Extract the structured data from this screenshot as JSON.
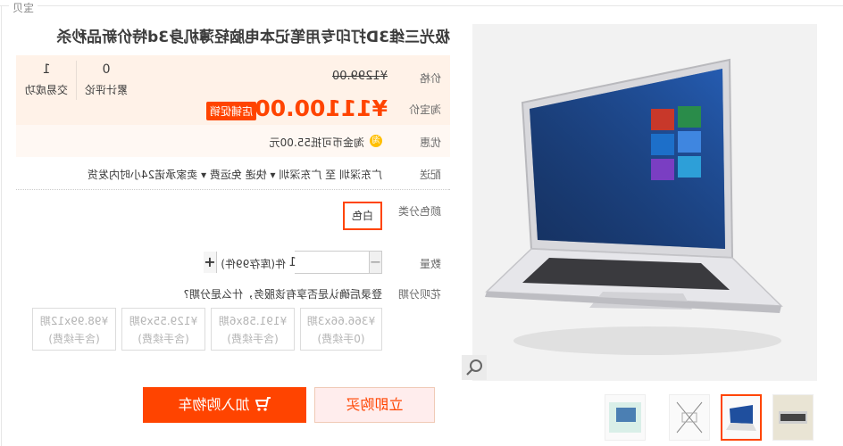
{
  "section_tag": "宝贝",
  "title": "极光三维3D打印专用笔记本电脑轻薄机身3d特价新品秒杀",
  "price": {
    "label": "价格",
    "original": "¥1299.00",
    "promo_label": "淘宝价",
    "current": "¥11100.00",
    "badge": "店铺促销"
  },
  "stats": [
    {
      "value": "0",
      "label": "累计评论"
    },
    {
      "value": "1",
      "label": "交易成功"
    }
  ],
  "promo": {
    "label": "优惠",
    "coin_icon": "coin-icon",
    "text": "淘金币可抵55.00元"
  },
  "shipping": {
    "label": "配送",
    "text": "广东深圳 至 广东深圳 ▾ 快递 免运费 ▾ 卖家承诺24小时内发货"
  },
  "color": {
    "label": "颜色分类",
    "selected": "白色"
  },
  "quantity": {
    "label": "数量",
    "minus": "−",
    "value": "1",
    "plus": "+",
    "unit_stock": "件(库存99件)"
  },
  "installment": {
    "label": "花呗分期",
    "note": "登录后确认是否享有该服务，什么是分期?",
    "options": [
      {
        "price": "¥366.66x3期",
        "fee": "(0手续费)"
      },
      {
        "price": "¥191.58x6期",
        "fee": "(含手续费)"
      },
      {
        "price": "¥129.55x9期",
        "fee": "(含手续费)"
      },
      {
        "price": "¥98.99x12期",
        "fee": "(含手续费)"
      }
    ]
  },
  "buttons": {
    "buy_now": "立即购买",
    "add_cart": "加入购物车",
    "cart_icon": "cart-icon"
  },
  "gallery": {
    "main_image": "laptop-photo",
    "zoom_icon": "magnifier-icon",
    "thumbnails": [
      "laptop-keyboard-thumb",
      "laptop-open-thumb",
      "laptop-diagram-thumb",
      "laptop-box-thumb"
    ],
    "active_index": 0
  },
  "colors": {
    "accent": "#ff4400",
    "price_bg": "#fff2e8"
  }
}
